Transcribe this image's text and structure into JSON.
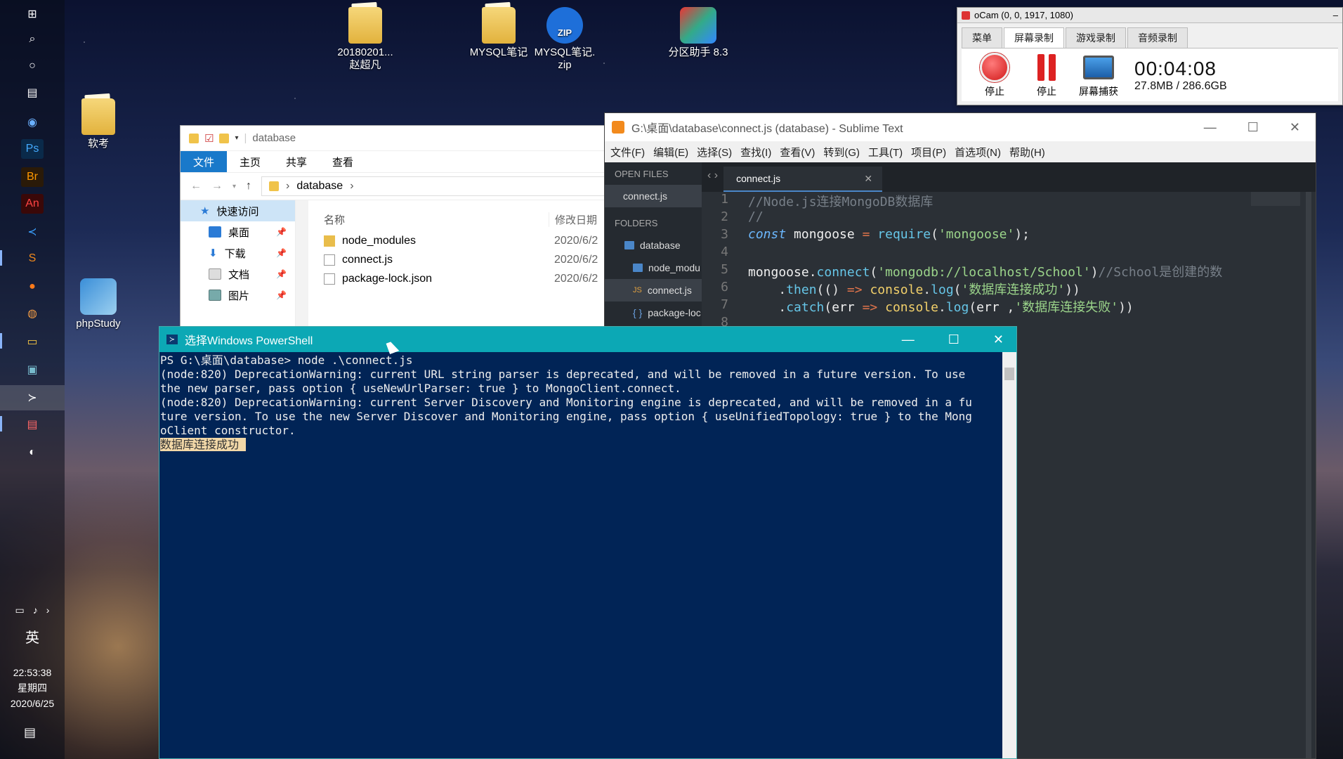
{
  "desktop": {
    "icons": [
      {
        "label": "20180201...\n赵超凡"
      },
      {
        "label": "MYSQL笔记"
      },
      {
        "label": "MYSQL笔记.\nzip"
      },
      {
        "label": "分区助手 8.3"
      },
      {
        "label": "软考"
      },
      {
        "label": "phpStudy"
      }
    ]
  },
  "taskbar": {
    "ime": "英",
    "time": "22:53:38",
    "weekday": "星期四",
    "date": "2020/6/25"
  },
  "ocam": {
    "title": "oCam (0, 0, 1917, 1080)",
    "tabs": [
      "菜单",
      "屏幕录制",
      "游戏录制",
      "音频录制"
    ],
    "buttons": [
      "停止",
      "停止",
      "屏幕捕获"
    ],
    "timer": "00:04:08",
    "size": "27.8MB / 286.6GB"
  },
  "explorer": {
    "title": "database",
    "ribbon": [
      "文件",
      "主页",
      "共享",
      "查看"
    ],
    "path": "database",
    "nav": [
      {
        "label": "快速访问"
      },
      {
        "label": "桌面"
      },
      {
        "label": "下载"
      },
      {
        "label": "文档"
      },
      {
        "label": "图片"
      }
    ],
    "columns": {
      "name": "名称",
      "date": "修改日期"
    },
    "files": [
      {
        "name": "node_modules",
        "date": "2020/6/2"
      },
      {
        "name": "connect.js",
        "date": "2020/6/2"
      },
      {
        "name": "package-lock.json",
        "date": "2020/6/2"
      }
    ]
  },
  "sublime": {
    "title": "G:\\桌面\\database\\connect.js (database) - Sublime Text",
    "menu": [
      "文件(F)",
      "编辑(E)",
      "选择(S)",
      "查找(I)",
      "查看(V)",
      "转到(G)",
      "工具(T)",
      "项目(P)",
      "首选项(N)",
      "帮助(H)"
    ],
    "open_files_header": "OPEN FILES",
    "open_file": "connect.js",
    "folders_header": "FOLDERS",
    "folders": [
      "database",
      "node_modu",
      "connect.js",
      "package-loc"
    ],
    "tab": "connect.js",
    "line_numbers": [
      "1",
      "2",
      "3",
      "4",
      "5",
      "6",
      "7",
      "8"
    ]
  },
  "powershell": {
    "title": "选择Windows PowerShell",
    "lines": [
      "PS G:\\桌面\\database> node .\\connect.js",
      "(node:820) DeprecationWarning: current URL string parser is deprecated, and will be removed in a future version. To use",
      "the new parser, pass option { useNewUrlParser: true } to MongoClient.connect.",
      "(node:820) DeprecationWarning: current Server Discovery and Monitoring engine is deprecated, and will be removed in a fu",
      "ture version. To use the new Server Discover and Monitoring engine, pass option { useUnifiedTopology: true } to the Mong",
      "oClient constructor."
    ],
    "highlight": "数据库连接成功 "
  }
}
